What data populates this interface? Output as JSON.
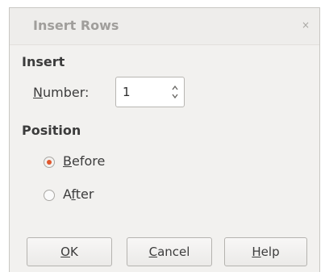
{
  "dialog": {
    "title": "Insert Rows",
    "close_icon": "close-icon",
    "close_glyph": "×"
  },
  "insert": {
    "heading": "Insert",
    "number_label_mnemonic": "N",
    "number_label_rest": "umber:",
    "number_value": "1"
  },
  "position": {
    "heading": "Position",
    "selected": "Before",
    "options": [
      {
        "mnemonic": "B",
        "prefix": "",
        "suffix": "efore",
        "checked": true
      },
      {
        "mnemonic": "f",
        "prefix": "A",
        "suffix": "ter",
        "checked": false
      }
    ]
  },
  "buttons": {
    "ok": {
      "mnemonic": "O",
      "rest": "K"
    },
    "cancel": {
      "mnemonic": "C",
      "rest": "ancel"
    },
    "help": {
      "mnemonic": "H",
      "rest": "elp"
    }
  },
  "colors": {
    "accent": "#e0562c",
    "background": "#f2f1ef"
  }
}
